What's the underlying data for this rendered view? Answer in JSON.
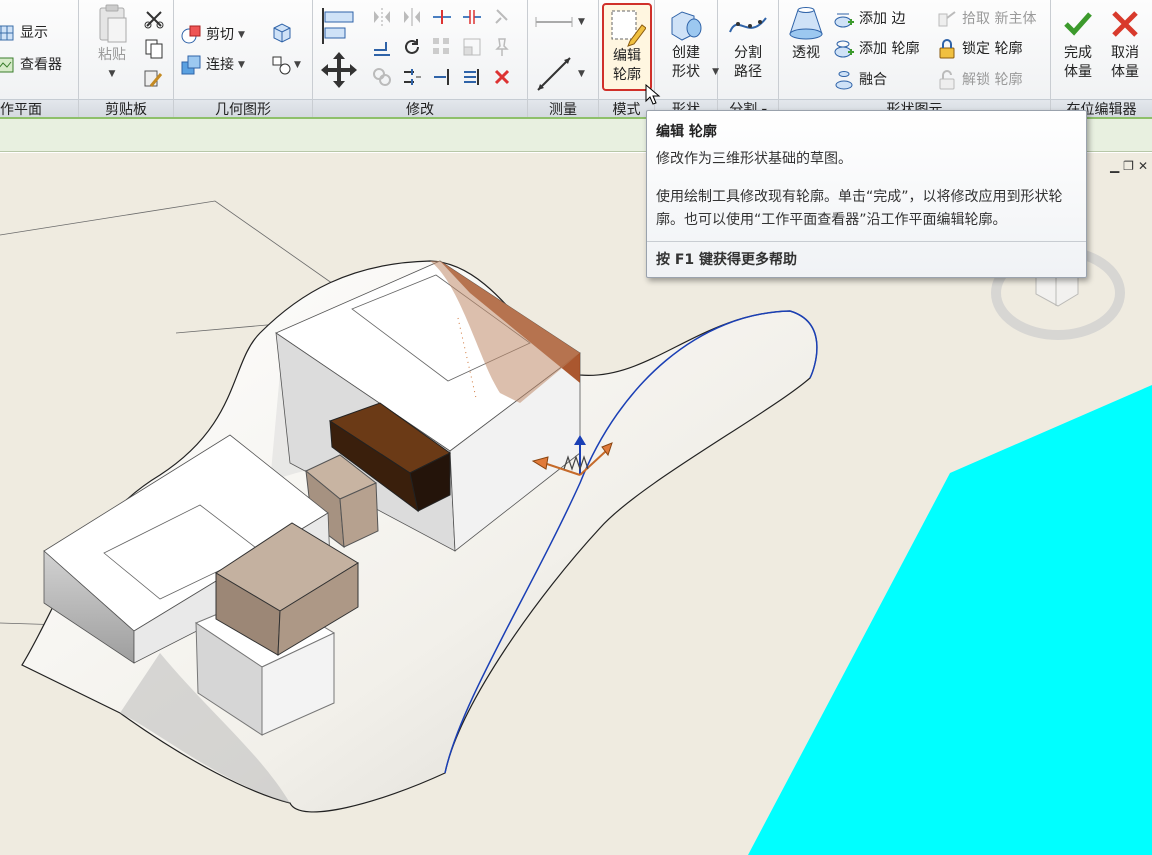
{
  "ribbon": {
    "work_plane": {
      "title": "作平面",
      "show": "显示",
      "viewer": "查看器"
    },
    "clipboard": {
      "title": "剪贴板",
      "paste": "粘贴"
    },
    "geometry": {
      "title": "几何图形",
      "cut": "剪切",
      "join": "连接"
    },
    "modify": {
      "title": "修改"
    },
    "measure": {
      "title": "测量"
    },
    "mode": {
      "title": "模式",
      "edit_profile_line1": "编辑",
      "edit_profile_line2": "轮廓"
    },
    "shape": {
      "title": "形状",
      "create_form_line1": "创建",
      "create_form_line2": "形状"
    },
    "divide": {
      "title": "分割",
      "divide_path_line1": "分割",
      "divide_path_line2": "路径"
    },
    "form_element": {
      "title": "形状图元",
      "xray": "透视",
      "add_edge": "添加 边",
      "add_profile": "添加 轮廓",
      "blend": "融合",
      "pick_host": "拾取 新主体",
      "lock_profile": "锁定 轮廓",
      "unlock_profile": "解锁 轮廓"
    },
    "in_place_editor": {
      "title": "在位编辑器",
      "finish_line1": "完成",
      "finish_line2": "体量",
      "cancel_line1": "取消",
      "cancel_line2": "体量"
    }
  },
  "tooltip": {
    "title": "编辑 轮廓",
    "subtitle": "修改作为三维形状基础的草图。",
    "body": "使用绘制工具修改现有轮廓。单击“完成”，以将修改应用到形状轮廓。也可以使用“工作平面查看器”沿工作平面编辑轮廓。",
    "help": "按 F1 键获得更多帮助"
  },
  "colors": {
    "accent_green": "#3c9a2c",
    "cancel_red": "#d83a2c",
    "highlight_border": "#d0302a",
    "cyan_fill": "#00ffff",
    "profile_line": "#1a3fb5"
  }
}
